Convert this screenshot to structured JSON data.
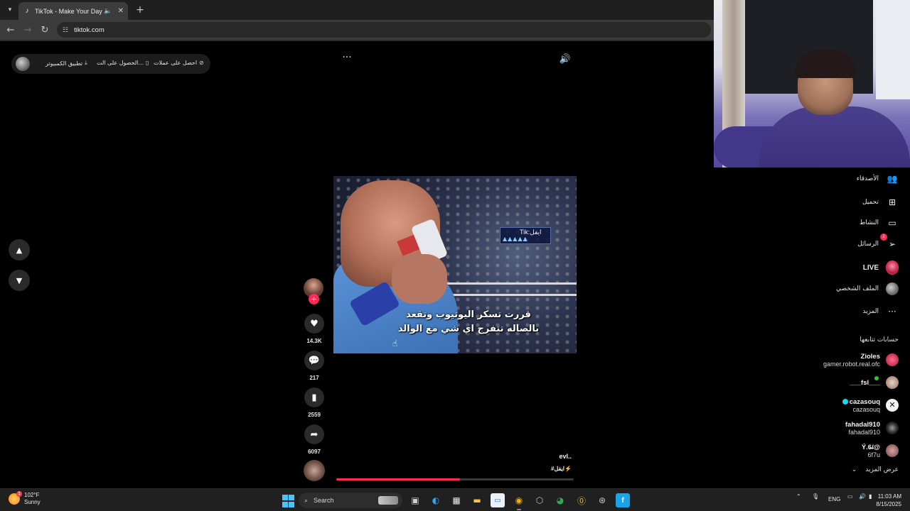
{
  "browser": {
    "tab_title": "TikTok - Make Your Day",
    "new_tab_symbol": "+",
    "url": "tiktok.com"
  },
  "promo": {
    "coins": "احصل على عملات",
    "get_app": "الحصول على الت...",
    "desktop_app": "تطبيق الكمبيوتر"
  },
  "video": {
    "watermark": "Tik:ايفل",
    "caption_line1": "قررت تسكر اليوتيوب وتقعد",
    "caption_line2": "بالصاله تتفرج اي شي مع الوالد",
    "username": "evl..",
    "hashtags": "#ايفل⚡",
    "progress": 0.52
  },
  "actions": {
    "likes": "14.3K",
    "comments": "217",
    "saves": "2559",
    "shares": "6097"
  },
  "sidebar": {
    "items": [
      {
        "label": "الأصدقاء",
        "icon": "friends-icon"
      },
      {
        "label": "تحميل",
        "icon": "upload-icon"
      },
      {
        "label": "النشاط",
        "icon": "activity-icon"
      },
      {
        "label": "الرسائل",
        "icon": "messages-icon",
        "badge": "1"
      },
      {
        "label": "LIVE",
        "icon": "live-icon"
      },
      {
        "label": "الملف الشخصي",
        "icon": "profile-icon"
      },
      {
        "label": "المزيد",
        "icon": "more-icon"
      }
    ],
    "following_title": "حسابات تتابعها",
    "accounts": [
      {
        "handle": "Zioles",
        "name": "gamer.robot.real.ofc"
      },
      {
        "handle": "___fsl___",
        "name": ""
      },
      {
        "handle": "cazasouq",
        "name": "cazasouq"
      },
      {
        "handle": "fahadal910",
        "name": "fahadal910"
      },
      {
        "handle": "Ý.6̶/@",
        "name": "6f7u"
      }
    ],
    "see_more": "عرض المزيد"
  },
  "taskbar": {
    "temperature": "102°F",
    "condition": "Sunny",
    "weather_badge": "1",
    "search": "Search",
    "language": "ENG",
    "time": "11:03 AM",
    "date": "8/15/2025"
  },
  "colors": {
    "accent": "#fe2c55",
    "verified": "#20d5ec",
    "online": "#25c73c"
  }
}
